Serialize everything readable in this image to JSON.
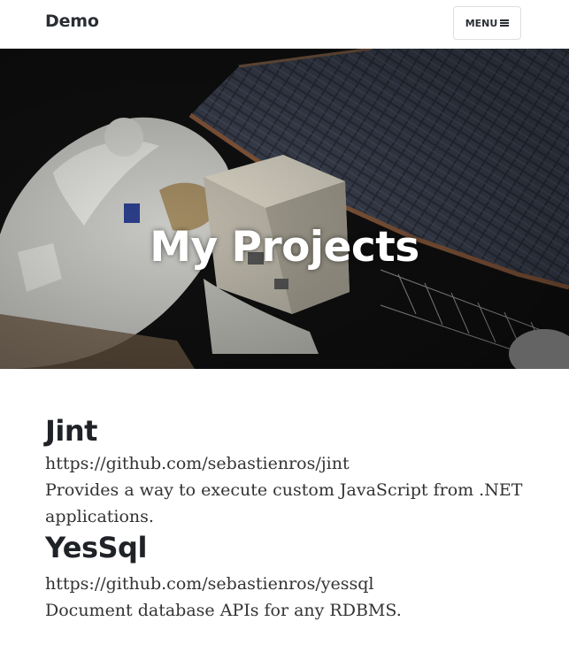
{
  "nav": {
    "brand": "Demo",
    "menu_label": "MENU",
    "menu_icon": "hamburger-icon"
  },
  "hero": {
    "title": "My Projects",
    "image": "astronaut-spacewalk-image"
  },
  "projects": [
    {
      "name": "Jint",
      "url": "https://github.com/sebastienros/jint",
      "description": "Provides a way to execute custom JavaScript from .NET applications."
    },
    {
      "name": "YesSql",
      "url": "https://github.com/sebastienros/yessql",
      "description": "Document database APIs for any RDBMS."
    }
  ],
  "colors": {
    "text_dark": "#2a2e33",
    "body_text": "#333333",
    "hero_overlay": "#121212"
  }
}
